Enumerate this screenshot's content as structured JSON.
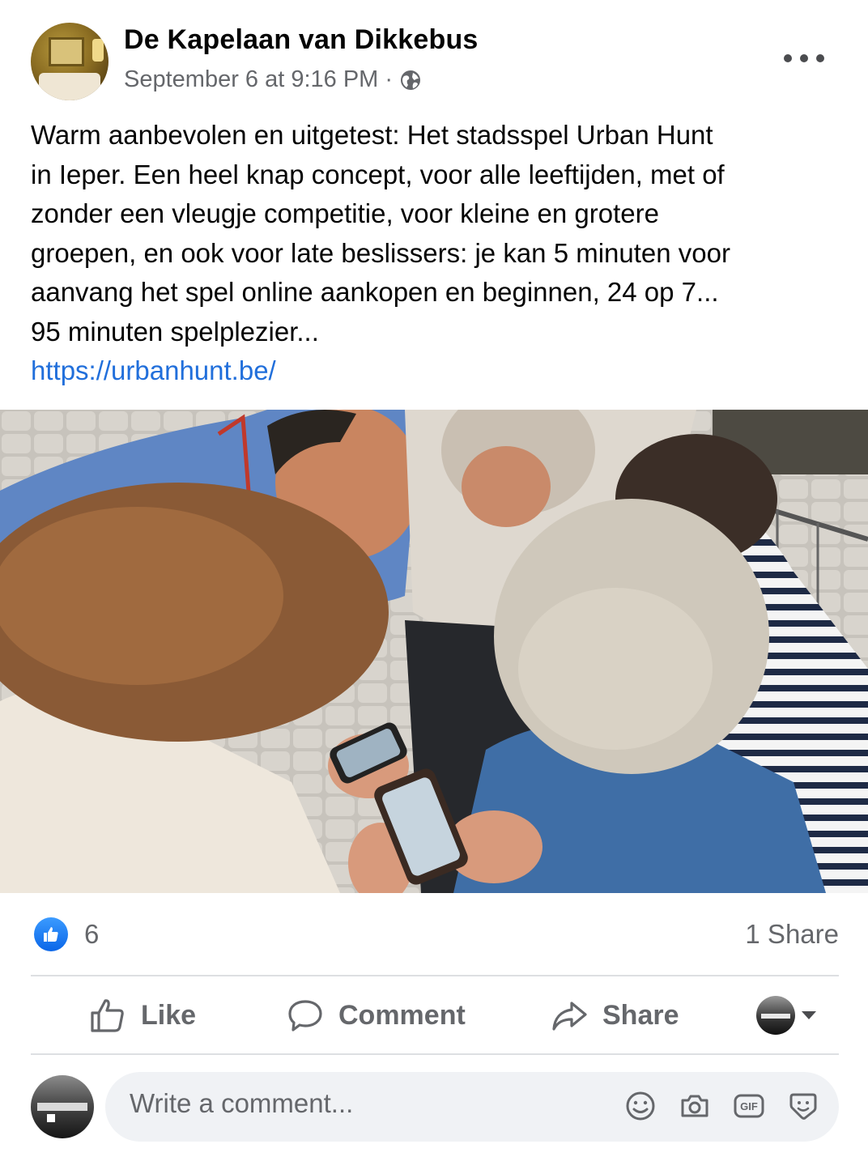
{
  "post": {
    "page_name": "De Kapelaan van Dikkebus",
    "timestamp": "September 6 at 9:16 PM",
    "separator": "·",
    "audience_icon": "globe-icon",
    "text_lines": [
      "Warm aanbevolen en uitgetest: Het stadsspel Urban Hunt",
      "in Ieper. Een heel knap concept, voor alle leeftijden, met of",
      "zonder een vleugje competitie, voor kleine en grotere",
      "groepen, en ook voor late beslissers: je kan 5 minuten voor",
      "aanvang het spel online aankopen en beginnen, 24 op 7...",
      "95 minuten spelplezier..."
    ],
    "link": "https://urbanhunt.be/"
  },
  "stats": {
    "reaction_icon": "like-reaction-icon",
    "like_count": "6",
    "share_count": "1 Share"
  },
  "actions": {
    "like_label": "Like",
    "comment_label": "Comment",
    "share_label": "Share"
  },
  "comment_box": {
    "placeholder": "Write a comment...",
    "icons": [
      "emoji-icon",
      "camera-icon",
      "gif-icon",
      "sticker-icon"
    ]
  },
  "colors": {
    "link": "#216fdb",
    "secondary_text": "#65676b",
    "like_blue": "#0a66e8",
    "input_bg": "#f0f2f5"
  }
}
